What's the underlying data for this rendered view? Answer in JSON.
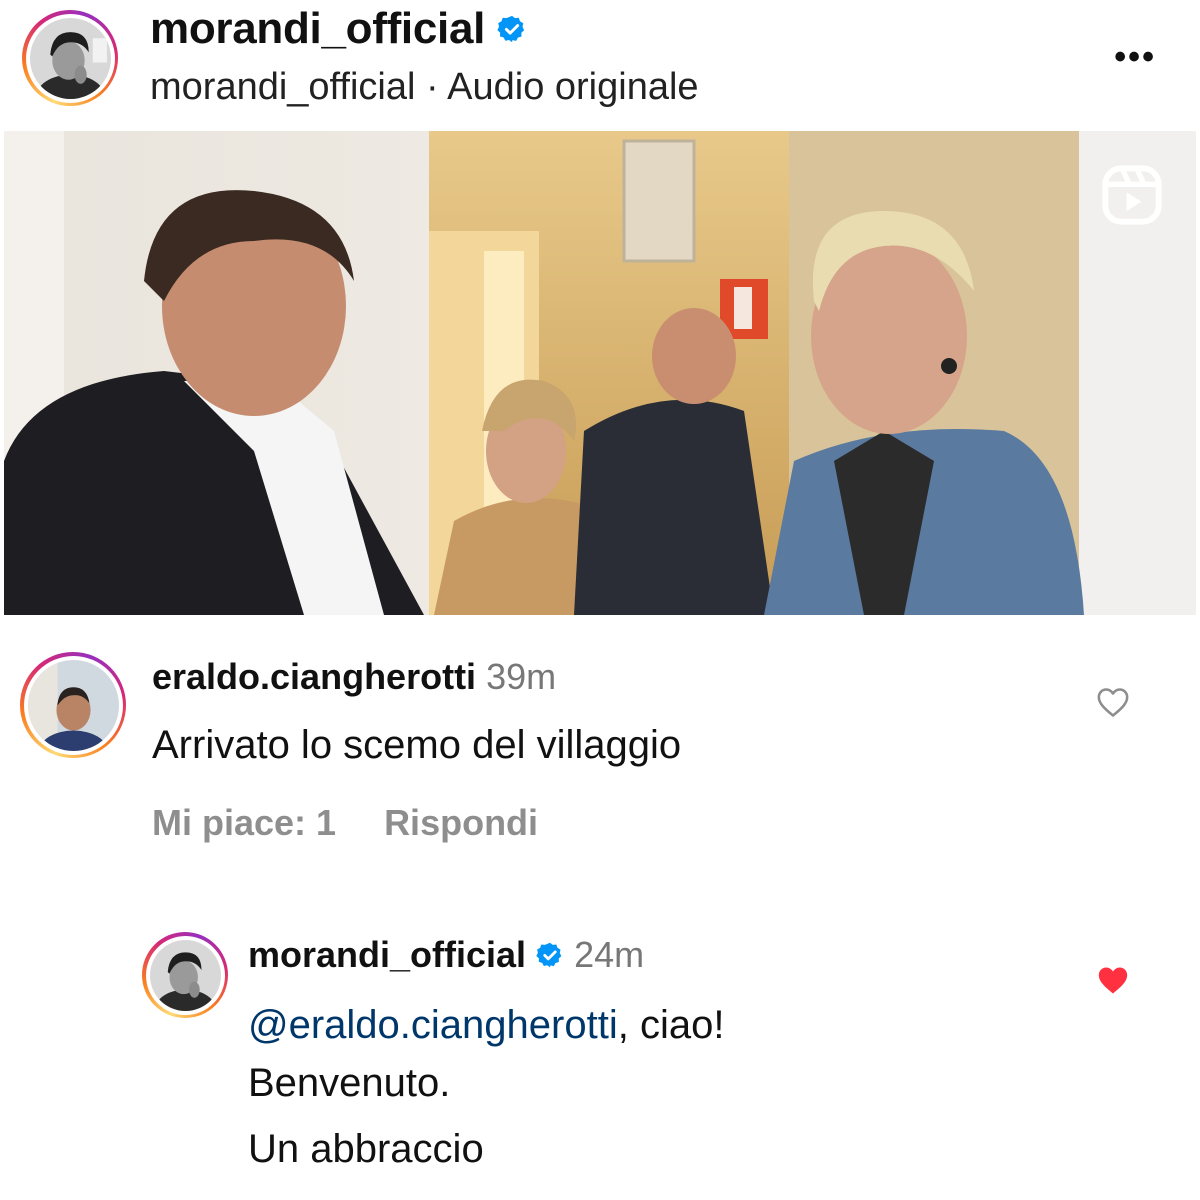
{
  "post": {
    "username": "morandi_official",
    "subtitle_user": "morandi_official",
    "subtitle_separator": "·",
    "subtitle_audio": "Audio originale",
    "more_label": "•••"
  },
  "comment": {
    "username": "eraldo.ciangherotti",
    "time": "39m",
    "text": "Arrivato lo scemo del villaggio",
    "likes_label": "Mi piace: 1",
    "reply_label": "Rispondi"
  },
  "reply": {
    "username": "morandi_official",
    "time": "24m",
    "mention": "@eraldo.ciangherotti",
    "line1_rest": ", ciao!",
    "line2": "Benvenuto.",
    "line3": "Un abbraccio"
  },
  "icons": {
    "verified": "verified-badge-icon",
    "reel": "reel-icon",
    "heart_outline": "heart-outline-icon",
    "heart_filled": "heart-filled-icon"
  },
  "colors": {
    "verified": "#0095f6",
    "mention": "#00376b",
    "liked_heart": "#ff3040",
    "muted_text": "#8e8e8e"
  }
}
